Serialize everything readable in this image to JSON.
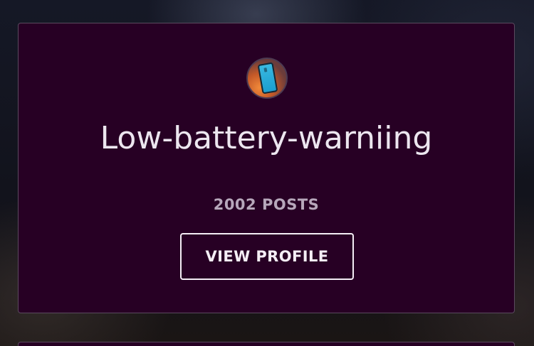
{
  "profile_card": {
    "username": "Low-battery-warniing",
    "posts_count": "2002 POSTS",
    "view_profile_label": "VIEW PROFILE",
    "avatar_icon": "phone-low-battery-avatar"
  },
  "colors": {
    "card_background": "#270024",
    "card_border": "#5a4a5e",
    "title_text": "#ece6ef",
    "secondary_text": "#b7a7bb",
    "button_border": "#f4eef5"
  }
}
